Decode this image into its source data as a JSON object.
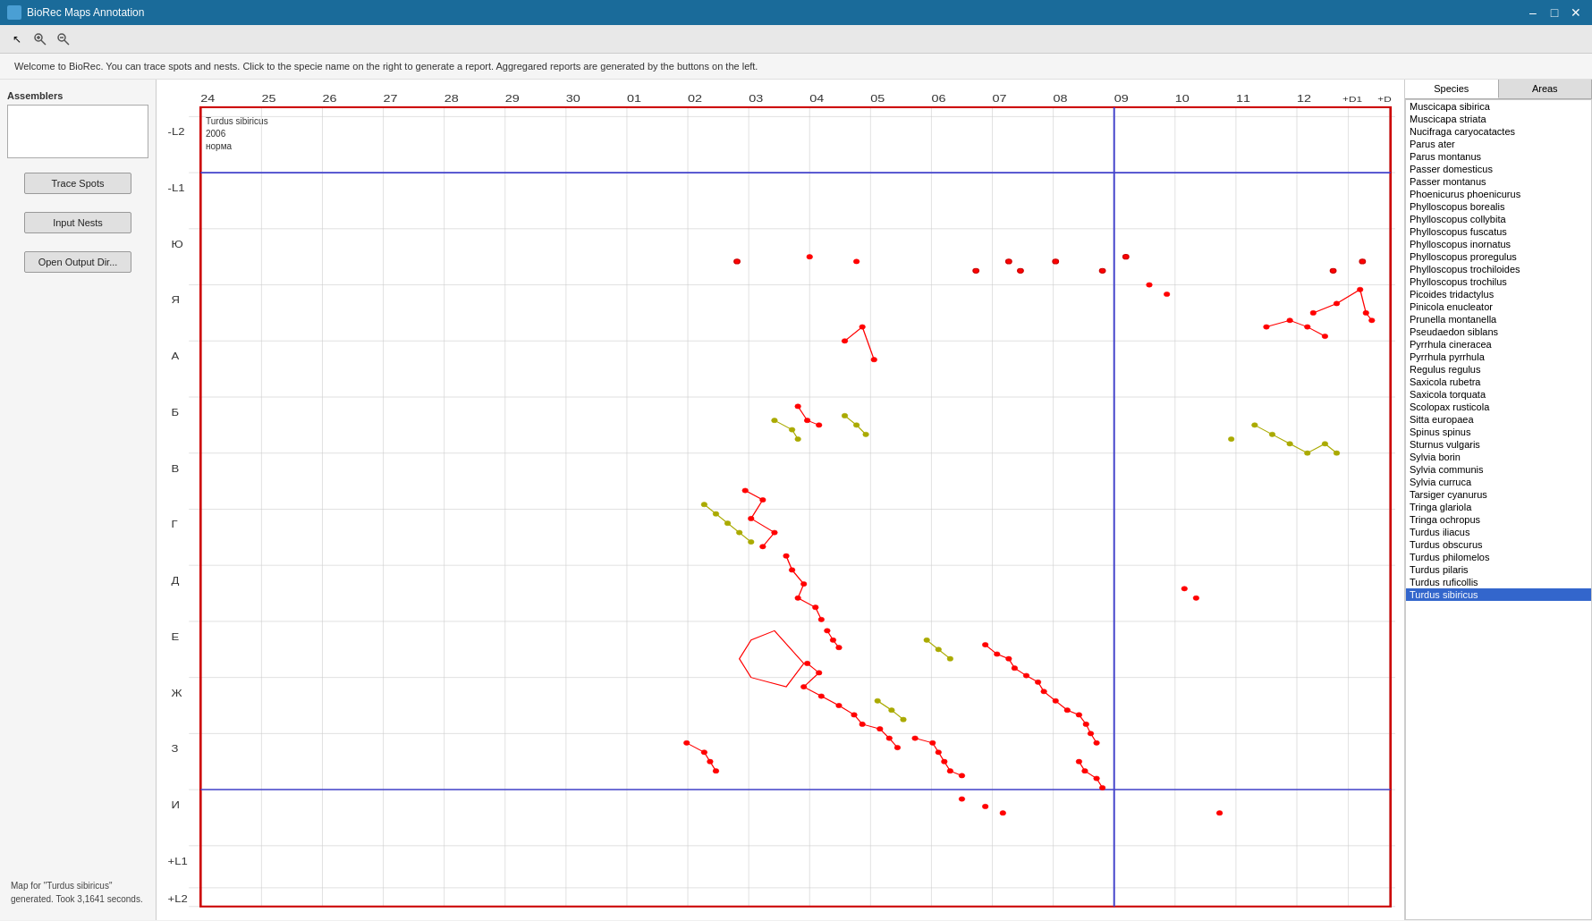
{
  "window": {
    "title": "BioRec Maps Annotation",
    "icon": "map-icon"
  },
  "toolbar": {
    "tools": [
      {
        "name": "pointer-icon",
        "symbol": "↖"
      },
      {
        "name": "zoom-in-icon",
        "symbol": "🔍"
      },
      {
        "name": "zoom-out-icon",
        "symbol": "🔎"
      }
    ]
  },
  "welcome": {
    "message": "Welcome to BioRec. You can trace spots and nests. Click to the specie name on the right to generate a report. Aggregared reports are generated by the buttons on the left."
  },
  "left_panel": {
    "assemblers_label": "Assemblers",
    "buttons": [
      {
        "id": "trace-spots",
        "label": "Trace Spots"
      },
      {
        "id": "input-nests",
        "label": "Input Nests"
      },
      {
        "id": "open-output-dir",
        "label": "Open Output Dir..."
      }
    ],
    "status": "Map for \"Turdus sibiricus\"\ngenerated. Took 3,1641 seconds."
  },
  "map": {
    "tooltip": {
      "species": "Turdus sibiricus",
      "year": "2006",
      "note": "норма"
    },
    "col_labels": [
      "24",
      "25",
      "26",
      "27",
      "28",
      "29",
      "30",
      "01",
      "02",
      "03",
      "04",
      "05",
      "06",
      "07",
      "08",
      "09",
      "10",
      "11",
      "12",
      "+D1",
      "+D"
    ],
    "row_labels": [
      "-L2",
      "-L1",
      "Ю",
      "Я",
      "А",
      "Б",
      "В",
      "Г",
      "Д",
      "Е",
      "Ж",
      "З",
      "И",
      "+L1",
      "+L2"
    ],
    "border_color": "#cc0000",
    "grid_color": "#cccccc",
    "highlight_col_color": "#4444cc",
    "highlight_row_color": "#4444cc"
  },
  "right_panel": {
    "tabs": [
      {
        "id": "species-tab",
        "label": "Species",
        "active": true
      },
      {
        "id": "areas-tab",
        "label": "Areas",
        "active": false
      }
    ],
    "species_list": [
      "Muscicapa sibirica",
      "Muscicapa striata",
      "Nucifraga caryocatactes",
      "Parus ater",
      "Parus montanus",
      "Passer domesticus",
      "Passer montanus",
      "Phoenicurus phoenicurus",
      "Phylloscopus borealis",
      "Phylloscopus collybita",
      "Phylloscopus fuscatus",
      "Phylloscopus inornatus",
      "Phylloscopus proregulus",
      "Phylloscopus trochiloides",
      "Phylloscopus trochilus",
      "Picoides tridactylus",
      "Pinicola enucleator",
      "Prunella montanella",
      "Pseudaedon siblans",
      "Pyrrhula cineracea",
      "Pyrrhula pyrrhula",
      "Regulus regulus",
      "Saxicola rubetra",
      "Saxicola torquata",
      "Scolopax rusticola",
      "Sitta europaea",
      "Spinus spinus",
      "Sturnus vulgaris",
      "Sylvia borin",
      "Sylvia communis",
      "Sylvia curruca",
      "Tarsiger cyanurus",
      "Tringa glariola",
      "Tringa ochropus",
      "Turdus iliacus",
      "Turdus obscurus",
      "Turdus philomelos",
      "Turdus pilaris",
      "Turdus ruficollis",
      "Turdus sibiricus"
    ],
    "selected_species": "Turdus sibiricus"
  }
}
